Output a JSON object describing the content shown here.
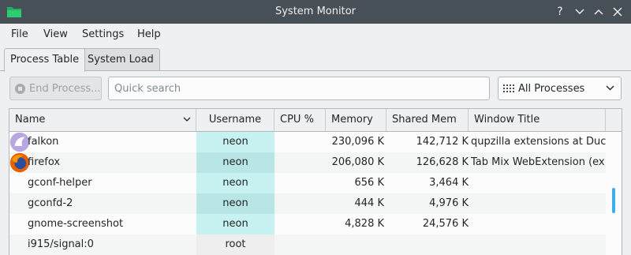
{
  "window": {
    "title": "System Monitor"
  },
  "menu": [
    "File",
    "View",
    "Settings",
    "Help"
  ],
  "tabs": [
    {
      "label": "Process Table",
      "active": true
    },
    {
      "label": "System Load",
      "active": false
    }
  ],
  "toolbar": {
    "end_process_label": "End Process...",
    "search_placeholder": "Quick search",
    "filter_value": "All Processes"
  },
  "columns": [
    "Name",
    "Username",
    "CPU %",
    "Memory",
    "Shared Mem",
    "Window Title"
  ],
  "rows": [
    {
      "name": "falkon",
      "icon": "falkon-icon",
      "user": "neon",
      "cpu": "",
      "memory": "230,096 K",
      "shared": "142,712 K",
      "title": "qupzilla extensions at Duc..."
    },
    {
      "name": "firefox",
      "icon": "firefox-icon",
      "user": "neon",
      "cpu": "",
      "memory": "206,080 K",
      "shared": "126,628 K",
      "title": "Tab Mix WebExtension (ex..."
    },
    {
      "name": "gconf-helper",
      "icon": "",
      "user": "neon",
      "cpu": "",
      "memory": "656 K",
      "shared": "3,464 K",
      "title": ""
    },
    {
      "name": "gconfd-2",
      "icon": "",
      "user": "neon",
      "cpu": "",
      "memory": "444 K",
      "shared": "4,976 K",
      "title": ""
    },
    {
      "name": "gnome-screenshot",
      "icon": "",
      "user": "neon",
      "cpu": "",
      "memory": "4,828 K",
      "shared": "24,576 K",
      "title": ""
    },
    {
      "name": "i915/signal:0",
      "icon": "",
      "user": "root",
      "cpu": "",
      "memory": "",
      "shared": "",
      "title": ""
    }
  ],
  "colors": {
    "titlebar": "#475057",
    "user_highlight": "#c8f2f2",
    "scrollbar": "#3daee9"
  }
}
